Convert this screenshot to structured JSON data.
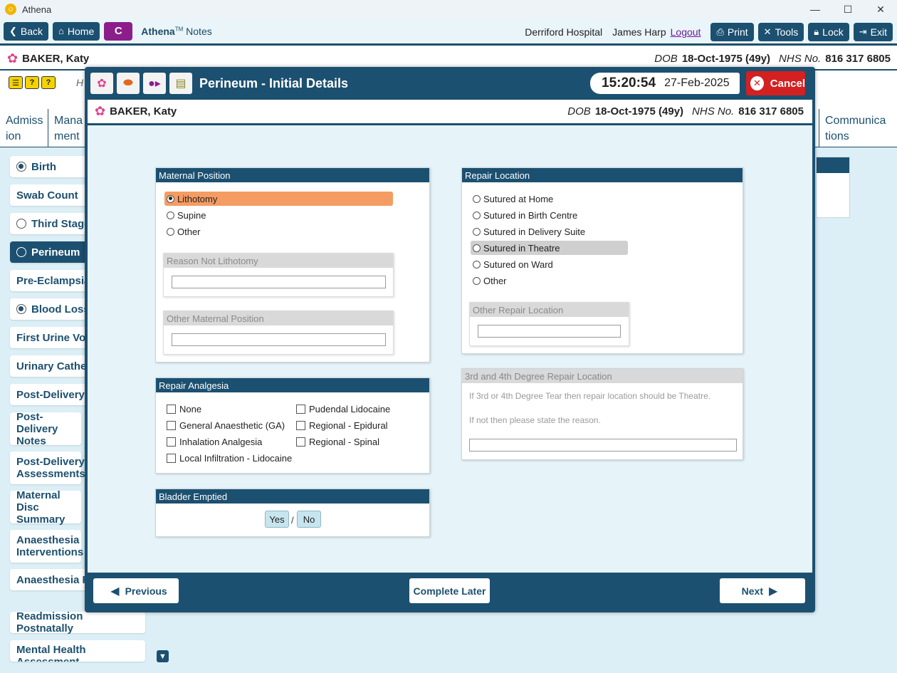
{
  "window": {
    "title": "Athena",
    "controls": [
      "—",
      "☐",
      "✕"
    ]
  },
  "toolbar": {
    "back": "Back",
    "home": "Home",
    "c_button": "C",
    "brand_name": "Athena",
    "brand_tm": "TM",
    "brand_suffix": " Notes",
    "hospital": "Derriford Hospital",
    "user": "James Harp",
    "logout": "Logout",
    "print": "Print",
    "tools": "Tools",
    "lock": "Lock",
    "exit": "Exit"
  },
  "patient": {
    "name": "BAKER, Katy",
    "dob_label": "DOB",
    "dob": "18-Oct-1975 (49y)",
    "nhs_label": "NHS No.",
    "nhs": "816 317 6805"
  },
  "background": {
    "h_text": "H",
    "tabs": [
      "Admiss ion",
      "Mana ment",
      "Communica tions"
    ],
    "sidebar": [
      {
        "label": "Birth",
        "radio": "on"
      },
      {
        "label": "Swab Count",
        "radio": "none"
      },
      {
        "label": "Third Stage",
        "radio": "off"
      },
      {
        "label": "Perineum",
        "radio": "off"
      },
      {
        "label": "Pre-Eclampsia",
        "radio": "none"
      },
      {
        "label": "Blood Loss",
        "radio": "on"
      },
      {
        "label": "First Urine Voi",
        "radio": "none"
      },
      {
        "label": "Urinary Cathe",
        "radio": "none"
      },
      {
        "label": "Post-Delivery",
        "radio": "none"
      },
      {
        "label": "Post-Delivery Notes",
        "radio": "none"
      },
      {
        "label": "Post-Delivery Assessments",
        "radio": "none"
      },
      {
        "label": "Maternal Disc Summary",
        "radio": "none"
      },
      {
        "label": "Anaesthesia Interventions",
        "radio": "none"
      },
      {
        "label": "Anaesthesia F",
        "radio": "none"
      },
      {
        "label": "Readmission Postnatally",
        "radio": "none"
      },
      {
        "label": "Mental Health Assessment",
        "radio": "none"
      }
    ]
  },
  "modal": {
    "title": "Perineum - Initial Details",
    "time": "15:20:54",
    "date": "27-Feb-2025",
    "cancel": "Cancel",
    "maternal_position": {
      "title": "Maternal Position",
      "options": [
        "Lithotomy",
        "Supine",
        "Other"
      ],
      "selected": "Lithotomy",
      "reason_title": "Reason Not Lithotomy",
      "other_title": "Other Maternal Position"
    },
    "repair_location": {
      "title": "Repair Location",
      "options": [
        "Sutured at Home",
        "Sutured in Birth Centre",
        "Sutured in Delivery Suite",
        "Sutured in Theatre",
        "Sutured on Ward",
        "Other"
      ],
      "hovered": "Sutured in Theatre",
      "other_title": "Other Repair Location"
    },
    "repair_analgesia": {
      "title": "Repair Analgesia",
      "left": [
        "None",
        "General Anaesthetic (GA)",
        "Inhalation Analgesia",
        "Local Infiltration - Lidocaine"
      ],
      "right": [
        "Pudendal Lidocaine",
        "Regional - Epidural",
        "Regional - Spinal"
      ]
    },
    "degree_repair": {
      "title": "3rd and 4th Degree Repair Location",
      "line1": "If 3rd or 4th Degree Tear then repair location should be Theatre.",
      "line2": "If not then please state the reason."
    },
    "bladder": {
      "title": "Bladder Emptied",
      "yes": "Yes",
      "slash": "/",
      "no": "No"
    },
    "footer": {
      "previous": "Previous",
      "complete_later": "Complete Later",
      "next": "Next"
    }
  }
}
